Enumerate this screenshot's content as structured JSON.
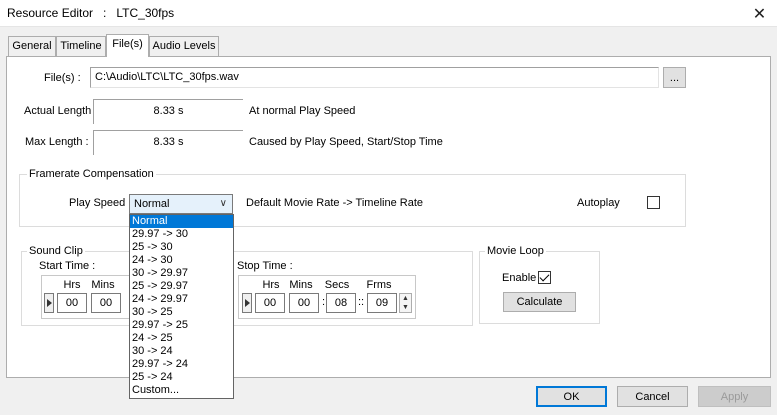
{
  "window": {
    "title": "Resource Editor   :   LTC_30fps",
    "close": "✕"
  },
  "tabs": [
    {
      "label": "General"
    },
    {
      "label": "Timeline"
    },
    {
      "label": "File(s)"
    },
    {
      "label": "Audio Levels"
    }
  ],
  "files": {
    "label": "File(s) :",
    "value": "C:\\Audio\\LTC\\LTC_30fps.wav",
    "browse": "..."
  },
  "actual_length": {
    "label": "Actual Length",
    "value": "8.33 s",
    "note": "At normal Play Speed"
  },
  "max_length": {
    "label": "Max Length :",
    "value": "8.33 s",
    "note": "Caused by Play Speed, Start/Stop Time"
  },
  "framerate": {
    "group_title": "Framerate Compensation",
    "play_speed_label": "Play Speed",
    "selected": "Normal",
    "default_note": "Default Movie Rate -> Timeline Rate",
    "autoplay_label": "Autoplay",
    "options": [
      "Normal",
      "29.97 -> 30",
      "25 -> 30",
      "24 -> 30",
      "30 -> 29.97",
      "25 -> 29.97",
      "24 -> 29.97",
      "30 -> 25",
      "29.97 -> 25",
      "24 -> 25",
      "30 -> 24",
      "29.97 -> 24",
      "25 -> 24",
      "Custom..."
    ]
  },
  "sound_clip": {
    "group_title": "Sound Clip",
    "start_label": "Start Time :",
    "stop_label": "Stop Time :",
    "headers": {
      "hrs": "Hrs",
      "mins": "Mins",
      "secs": "Secs",
      "frms": "Frms"
    },
    "start": {
      "hrs": "00",
      "mins": "00"
    },
    "stop": {
      "hrs": "00",
      "mins": "00",
      "secs": "08",
      "frms": "09"
    },
    "sep_colon": ":",
    "sep_frames": "::"
  },
  "movie_loop": {
    "group_title": "Movie Loop",
    "enable_label": "Enable",
    "calculate": "Calculate"
  },
  "footer": {
    "ok": "OK",
    "cancel": "Cancel",
    "apply": "Apply"
  },
  "colors": {
    "accent": "#0078d7",
    "panel": "#ffffff",
    "chrome": "#f0f0f0"
  }
}
